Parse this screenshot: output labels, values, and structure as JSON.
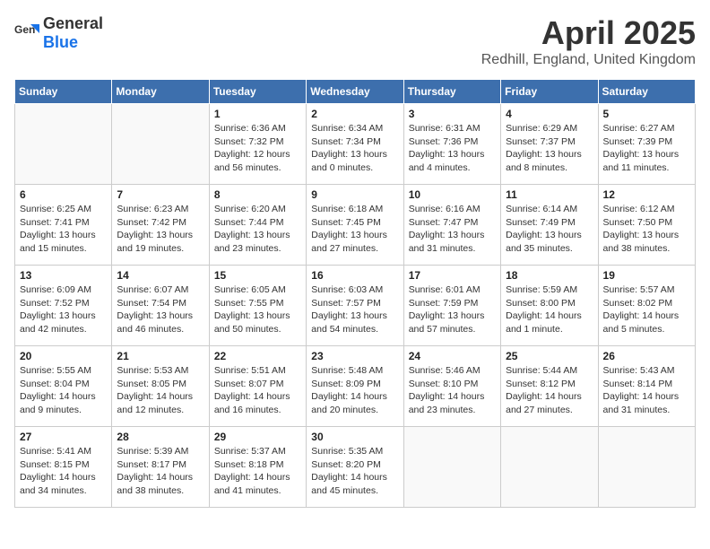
{
  "header": {
    "logo_general": "General",
    "logo_blue": "Blue",
    "title": "April 2025",
    "subtitle": "Redhill, England, United Kingdom"
  },
  "weekdays": [
    "Sunday",
    "Monday",
    "Tuesday",
    "Wednesday",
    "Thursday",
    "Friday",
    "Saturday"
  ],
  "weeks": [
    [
      {
        "day": "",
        "sunrise": "",
        "sunset": "",
        "daylight": ""
      },
      {
        "day": "",
        "sunrise": "",
        "sunset": "",
        "daylight": ""
      },
      {
        "day": "1",
        "sunrise": "Sunrise: 6:36 AM",
        "sunset": "Sunset: 7:32 PM",
        "daylight": "Daylight: 12 hours and 56 minutes."
      },
      {
        "day": "2",
        "sunrise": "Sunrise: 6:34 AM",
        "sunset": "Sunset: 7:34 PM",
        "daylight": "Daylight: 13 hours and 0 minutes."
      },
      {
        "day": "3",
        "sunrise": "Sunrise: 6:31 AM",
        "sunset": "Sunset: 7:36 PM",
        "daylight": "Daylight: 13 hours and 4 minutes."
      },
      {
        "day": "4",
        "sunrise": "Sunrise: 6:29 AM",
        "sunset": "Sunset: 7:37 PM",
        "daylight": "Daylight: 13 hours and 8 minutes."
      },
      {
        "day": "5",
        "sunrise": "Sunrise: 6:27 AM",
        "sunset": "Sunset: 7:39 PM",
        "daylight": "Daylight: 13 hours and 11 minutes."
      }
    ],
    [
      {
        "day": "6",
        "sunrise": "Sunrise: 6:25 AM",
        "sunset": "Sunset: 7:41 PM",
        "daylight": "Daylight: 13 hours and 15 minutes."
      },
      {
        "day": "7",
        "sunrise": "Sunrise: 6:23 AM",
        "sunset": "Sunset: 7:42 PM",
        "daylight": "Daylight: 13 hours and 19 minutes."
      },
      {
        "day": "8",
        "sunrise": "Sunrise: 6:20 AM",
        "sunset": "Sunset: 7:44 PM",
        "daylight": "Daylight: 13 hours and 23 minutes."
      },
      {
        "day": "9",
        "sunrise": "Sunrise: 6:18 AM",
        "sunset": "Sunset: 7:45 PM",
        "daylight": "Daylight: 13 hours and 27 minutes."
      },
      {
        "day": "10",
        "sunrise": "Sunrise: 6:16 AM",
        "sunset": "Sunset: 7:47 PM",
        "daylight": "Daylight: 13 hours and 31 minutes."
      },
      {
        "day": "11",
        "sunrise": "Sunrise: 6:14 AM",
        "sunset": "Sunset: 7:49 PM",
        "daylight": "Daylight: 13 hours and 35 minutes."
      },
      {
        "day": "12",
        "sunrise": "Sunrise: 6:12 AM",
        "sunset": "Sunset: 7:50 PM",
        "daylight": "Daylight: 13 hours and 38 minutes."
      }
    ],
    [
      {
        "day": "13",
        "sunrise": "Sunrise: 6:09 AM",
        "sunset": "Sunset: 7:52 PM",
        "daylight": "Daylight: 13 hours and 42 minutes."
      },
      {
        "day": "14",
        "sunrise": "Sunrise: 6:07 AM",
        "sunset": "Sunset: 7:54 PM",
        "daylight": "Daylight: 13 hours and 46 minutes."
      },
      {
        "day": "15",
        "sunrise": "Sunrise: 6:05 AM",
        "sunset": "Sunset: 7:55 PM",
        "daylight": "Daylight: 13 hours and 50 minutes."
      },
      {
        "day": "16",
        "sunrise": "Sunrise: 6:03 AM",
        "sunset": "Sunset: 7:57 PM",
        "daylight": "Daylight: 13 hours and 54 minutes."
      },
      {
        "day": "17",
        "sunrise": "Sunrise: 6:01 AM",
        "sunset": "Sunset: 7:59 PM",
        "daylight": "Daylight: 13 hours and 57 minutes."
      },
      {
        "day": "18",
        "sunrise": "Sunrise: 5:59 AM",
        "sunset": "Sunset: 8:00 PM",
        "daylight": "Daylight: 14 hours and 1 minute."
      },
      {
        "day": "19",
        "sunrise": "Sunrise: 5:57 AM",
        "sunset": "Sunset: 8:02 PM",
        "daylight": "Daylight: 14 hours and 5 minutes."
      }
    ],
    [
      {
        "day": "20",
        "sunrise": "Sunrise: 5:55 AM",
        "sunset": "Sunset: 8:04 PM",
        "daylight": "Daylight: 14 hours and 9 minutes."
      },
      {
        "day": "21",
        "sunrise": "Sunrise: 5:53 AM",
        "sunset": "Sunset: 8:05 PM",
        "daylight": "Daylight: 14 hours and 12 minutes."
      },
      {
        "day": "22",
        "sunrise": "Sunrise: 5:51 AM",
        "sunset": "Sunset: 8:07 PM",
        "daylight": "Daylight: 14 hours and 16 minutes."
      },
      {
        "day": "23",
        "sunrise": "Sunrise: 5:48 AM",
        "sunset": "Sunset: 8:09 PM",
        "daylight": "Daylight: 14 hours and 20 minutes."
      },
      {
        "day": "24",
        "sunrise": "Sunrise: 5:46 AM",
        "sunset": "Sunset: 8:10 PM",
        "daylight": "Daylight: 14 hours and 23 minutes."
      },
      {
        "day": "25",
        "sunrise": "Sunrise: 5:44 AM",
        "sunset": "Sunset: 8:12 PM",
        "daylight": "Daylight: 14 hours and 27 minutes."
      },
      {
        "day": "26",
        "sunrise": "Sunrise: 5:43 AM",
        "sunset": "Sunset: 8:14 PM",
        "daylight": "Daylight: 14 hours and 31 minutes."
      }
    ],
    [
      {
        "day": "27",
        "sunrise": "Sunrise: 5:41 AM",
        "sunset": "Sunset: 8:15 PM",
        "daylight": "Daylight: 14 hours and 34 minutes."
      },
      {
        "day": "28",
        "sunrise": "Sunrise: 5:39 AM",
        "sunset": "Sunset: 8:17 PM",
        "daylight": "Daylight: 14 hours and 38 minutes."
      },
      {
        "day": "29",
        "sunrise": "Sunrise: 5:37 AM",
        "sunset": "Sunset: 8:18 PM",
        "daylight": "Daylight: 14 hours and 41 minutes."
      },
      {
        "day": "30",
        "sunrise": "Sunrise: 5:35 AM",
        "sunset": "Sunset: 8:20 PM",
        "daylight": "Daylight: 14 hours and 45 minutes."
      },
      {
        "day": "",
        "sunrise": "",
        "sunset": "",
        "daylight": ""
      },
      {
        "day": "",
        "sunrise": "",
        "sunset": "",
        "daylight": ""
      },
      {
        "day": "",
        "sunrise": "",
        "sunset": "",
        "daylight": ""
      }
    ]
  ]
}
